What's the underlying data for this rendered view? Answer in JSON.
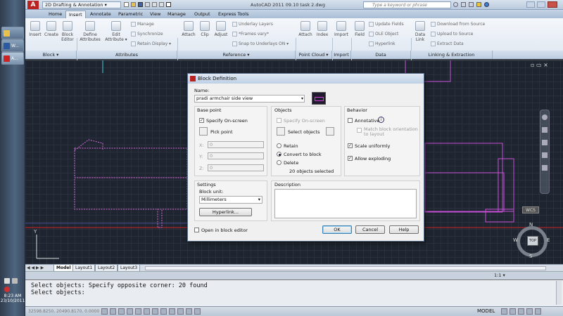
{
  "window": {
    "title": "AutoCAD 2011   09.10 task 2.dwg",
    "workspace": "2D Drafting & Annotation",
    "search_placeholder": "Type a keyword or phrase"
  },
  "taskbar": {
    "buttons": [
      "",
      "W...",
      "A..."
    ],
    "time": "8:23 AM",
    "date": "23/10/2011"
  },
  "tabs": [
    "Home",
    "Insert",
    "Annotate",
    "Parametric",
    "View",
    "Manage",
    "Output",
    "Express Tools"
  ],
  "ribbon": {
    "block": {
      "insert": "Insert",
      "create": "Create",
      "block_editor": "Block\nEditor",
      "title": "Block ▾"
    },
    "attributes": {
      "define": "Define\nAttributes",
      "edit": "Edit\nAttribute ▾",
      "manage": "Manage",
      "synchronize": "Synchronize",
      "retain_display": "Retain Display ▾",
      "title": "Attributes"
    },
    "reference": {
      "attach": "Attach",
      "clip": "Clip",
      "adjust": "Adjust",
      "underlay_layers": "Underlay Layers",
      "frames": "*Frames vary*",
      "snap": "Snap to Underlays ON ▾",
      "title": "Reference ▾"
    },
    "point_cloud": {
      "attach": "Attach",
      "index": "Index",
      "title": "Point Cloud ▾"
    },
    "import": {
      "import": "Import",
      "title": "Import"
    },
    "data": {
      "field": "Field",
      "update_fields": "Update Fields",
      "ole_object": "OLE Object",
      "hyperlink": "Hyperlink",
      "title": "Data"
    },
    "linking": {
      "data_link": "Data\nLink",
      "download": "Download from Source",
      "upload": "Upload to Source",
      "extract": "Extract  Data",
      "title": "Linking & Extraction"
    }
  },
  "layout_tabs": [
    "Model",
    "Layout1",
    "Layout2",
    "Layout3"
  ],
  "command": {
    "line1": "Select objects: Specify opposite corner: 20 found",
    "line2": "Select objects:"
  },
  "status": {
    "coords": "32598.8250, 20490.8170, 0.0000",
    "model": "MODEL",
    "scale": "1:1 ▾"
  },
  "viewcube": {
    "n": "N",
    "s": "S",
    "e": "E",
    "w": "W",
    "top": "TOP",
    "wcs": "WCS"
  },
  "dialog": {
    "title": "Block Definition",
    "name_label": "Name:",
    "name_value": "pradi armchair side view",
    "base_point": {
      "title": "Base point",
      "specify": "Specify On-screen",
      "pick": "Pick point",
      "x": "X:",
      "y": "Y:",
      "z": "Z:",
      "x_val": "0",
      "y_val": "0",
      "z_val": "0"
    },
    "objects": {
      "title": "Objects",
      "specify": "Specify On-screen",
      "select": "Select objects",
      "retain": "Retain",
      "convert": "Convert to block",
      "delete": "Delete",
      "count": "20 objects selected"
    },
    "behavior": {
      "title": "Behavior",
      "annotative": "Annotative",
      "match": "Match block orientation\nto layout",
      "scale": "Scale uniformly",
      "exploding": "Allow exploding"
    },
    "settings": {
      "title": "Settings",
      "unit_label": "Block unit:",
      "unit_value": "Millimeters",
      "hyperlink": "Hyperlink..."
    },
    "description": {
      "title": "Description"
    },
    "open_editor": "Open in block editor",
    "ok": "OK",
    "cancel": "Cancel",
    "help": "Help"
  }
}
